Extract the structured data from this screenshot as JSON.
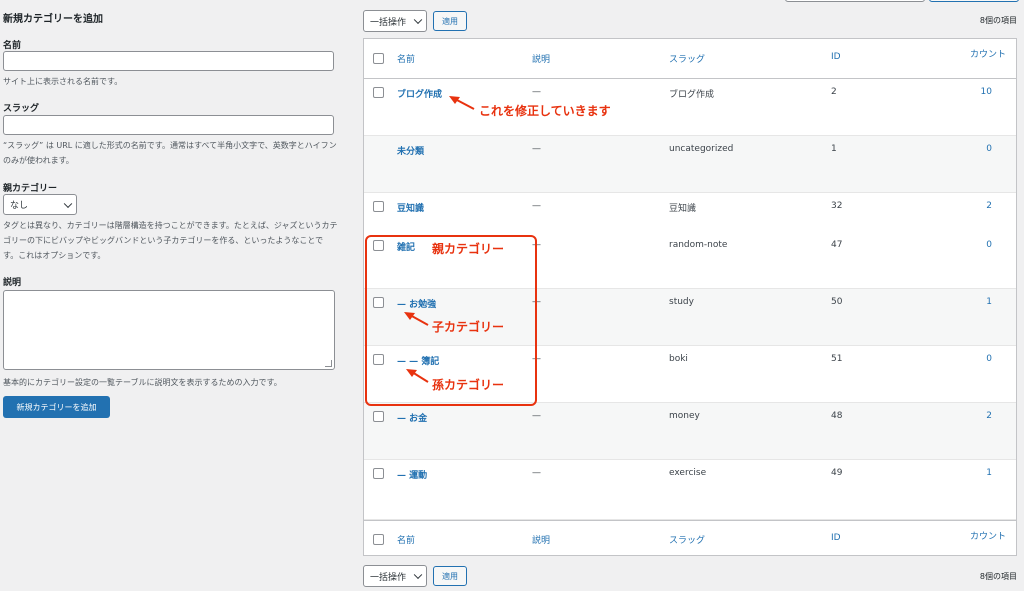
{
  "form": {
    "title": "新規カテゴリーを追加",
    "name_label": "名前",
    "name_help": "サイト上に表示される名前です。",
    "slug_label": "スラッグ",
    "slug_help": "“スラッグ” は URL に適した形式の名前です。通常はすべて半角小文字で、英数字とハイフンのみが使われます。",
    "parent_label": "親カテゴリー",
    "parent_value": "なし",
    "parent_help": "タグとは異なり、カテゴリーは階層構造を持つことができます。たとえば、ジャズというカテゴリーの下にビバップやビッグバンドという子カテゴリーを作る、といったようなことです。これはオプションです。",
    "desc_label": "説明",
    "desc_help": "基本的にカテゴリー設定の一覧テーブルに説明文を表示するための入力です。",
    "submit": "新規カテゴリーを追加"
  },
  "toolbar": {
    "bulk": "一括操作",
    "apply": "適用",
    "count": "8個の項目"
  },
  "table": {
    "headers": {
      "name": "名前",
      "desc": "説明",
      "slug": "スラッグ",
      "id": "ID",
      "count": "カウント"
    },
    "rows": [
      {
        "name": "ブログ作成",
        "desc": "—",
        "slug": "ブログ作成",
        "id": "2",
        "count": "10",
        "checkbox": true
      },
      {
        "name": "未分類",
        "desc": "—",
        "slug": "uncategorized",
        "id": "1",
        "count": "0",
        "checkbox": false
      },
      {
        "name": "豆知識",
        "desc": "—",
        "slug": "豆知識",
        "id": "32",
        "count": "2",
        "checkbox": true
      },
      {
        "name": "雑記",
        "desc": "—",
        "slug": "random-note",
        "id": "47",
        "count": "0",
        "checkbox": true
      },
      {
        "name": "— お勉強",
        "desc": "—",
        "slug": "study",
        "id": "50",
        "count": "1",
        "checkbox": true
      },
      {
        "name": "— — 簿記",
        "desc": "—",
        "slug": "boki",
        "id": "51",
        "count": "0",
        "checkbox": true
      },
      {
        "name": "— お金",
        "desc": "—",
        "slug": "money",
        "id": "48",
        "count": "2",
        "checkbox": true
      },
      {
        "name": "— 運動",
        "desc": "—",
        "slug": "exercise",
        "id": "49",
        "count": "1",
        "checkbox": true
      }
    ]
  },
  "annotations": {
    "edit_note": "これを修正していきます",
    "parent": "親カテゴリー",
    "child": "子カテゴリー",
    "grandchild": "孫カテゴリー",
    "color": "#e8320f"
  }
}
